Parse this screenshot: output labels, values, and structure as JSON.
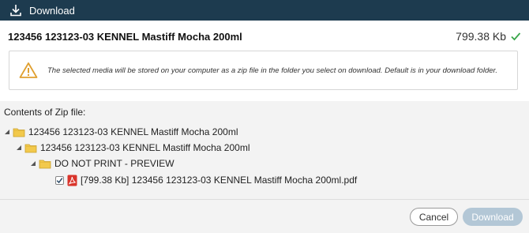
{
  "window": {
    "title": "Download",
    "icon": "download-icon"
  },
  "header": {
    "item_name": "123456 123123-03 KENNEL Mastiff Mocha 200ml",
    "size": "799.38 Kb",
    "status_icon": "check-icon",
    "status_color": "#3aa64b"
  },
  "notice": {
    "icon": "warning-icon",
    "text": "The selected media will be stored on your computer as a zip file in the folder you select on download. Default is in your download folder."
  },
  "contents": {
    "label": "Contents of Zip file:",
    "tree": [
      {
        "level": 0,
        "type": "folder",
        "label": "123456 123123-03 KENNEL Mastiff Mocha 200ml",
        "expanded": true
      },
      {
        "level": 1,
        "type": "folder",
        "label": "123456 123123-03 KENNEL Mastiff Mocha 200ml",
        "expanded": true
      },
      {
        "level": 2,
        "type": "folder",
        "label": "DO NOT PRINT - PREVIEW",
        "expanded": true
      },
      {
        "level": 3,
        "type": "file",
        "checked": true,
        "file_icon": "pdf-icon",
        "label": "[799.38 Kb] 123456 123123-03 KENNEL Mastiff Mocha 200ml.pdf"
      }
    ]
  },
  "footer": {
    "cancel_label": "Cancel",
    "download_label": "Download",
    "download_enabled": false
  },
  "colors": {
    "titlebar": "#1d3b4f",
    "download_button_disabled": "#b3c7d6",
    "folder": "#f2c94c",
    "pdf": "#d9342b",
    "warning": "#e0a030"
  }
}
